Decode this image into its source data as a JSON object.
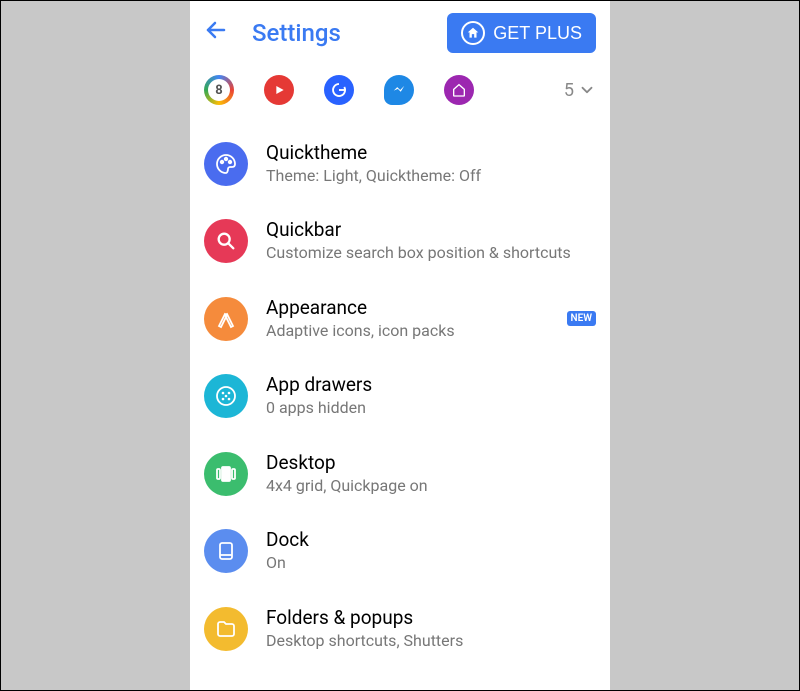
{
  "header": {
    "title": "Settings",
    "getPlusLabel": "GET PLUS"
  },
  "appRow": {
    "colorfulNumber": "8",
    "count": "5"
  },
  "settings": [
    {
      "title": "Quicktheme",
      "subtitle": "Theme: Light, Quicktheme: Off",
      "icon": "quicktheme",
      "badge": null
    },
    {
      "title": "Quickbar",
      "subtitle": "Customize search box position & shortcuts",
      "icon": "quickbar",
      "badge": null
    },
    {
      "title": "Appearance",
      "subtitle": "Adaptive icons, icon packs",
      "icon": "appearance",
      "badge": "NEW"
    },
    {
      "title": "App drawers",
      "subtitle": "0 apps hidden",
      "icon": "appdrawers",
      "badge": null
    },
    {
      "title": "Desktop",
      "subtitle": "4x4 grid, Quickpage on",
      "icon": "desktop",
      "badge": null
    },
    {
      "title": "Dock",
      "subtitle": "On",
      "icon": "dock",
      "badge": null
    },
    {
      "title": "Folders & popups",
      "subtitle": "Desktop shortcuts, Shutters",
      "icon": "folders",
      "badge": null
    }
  ]
}
